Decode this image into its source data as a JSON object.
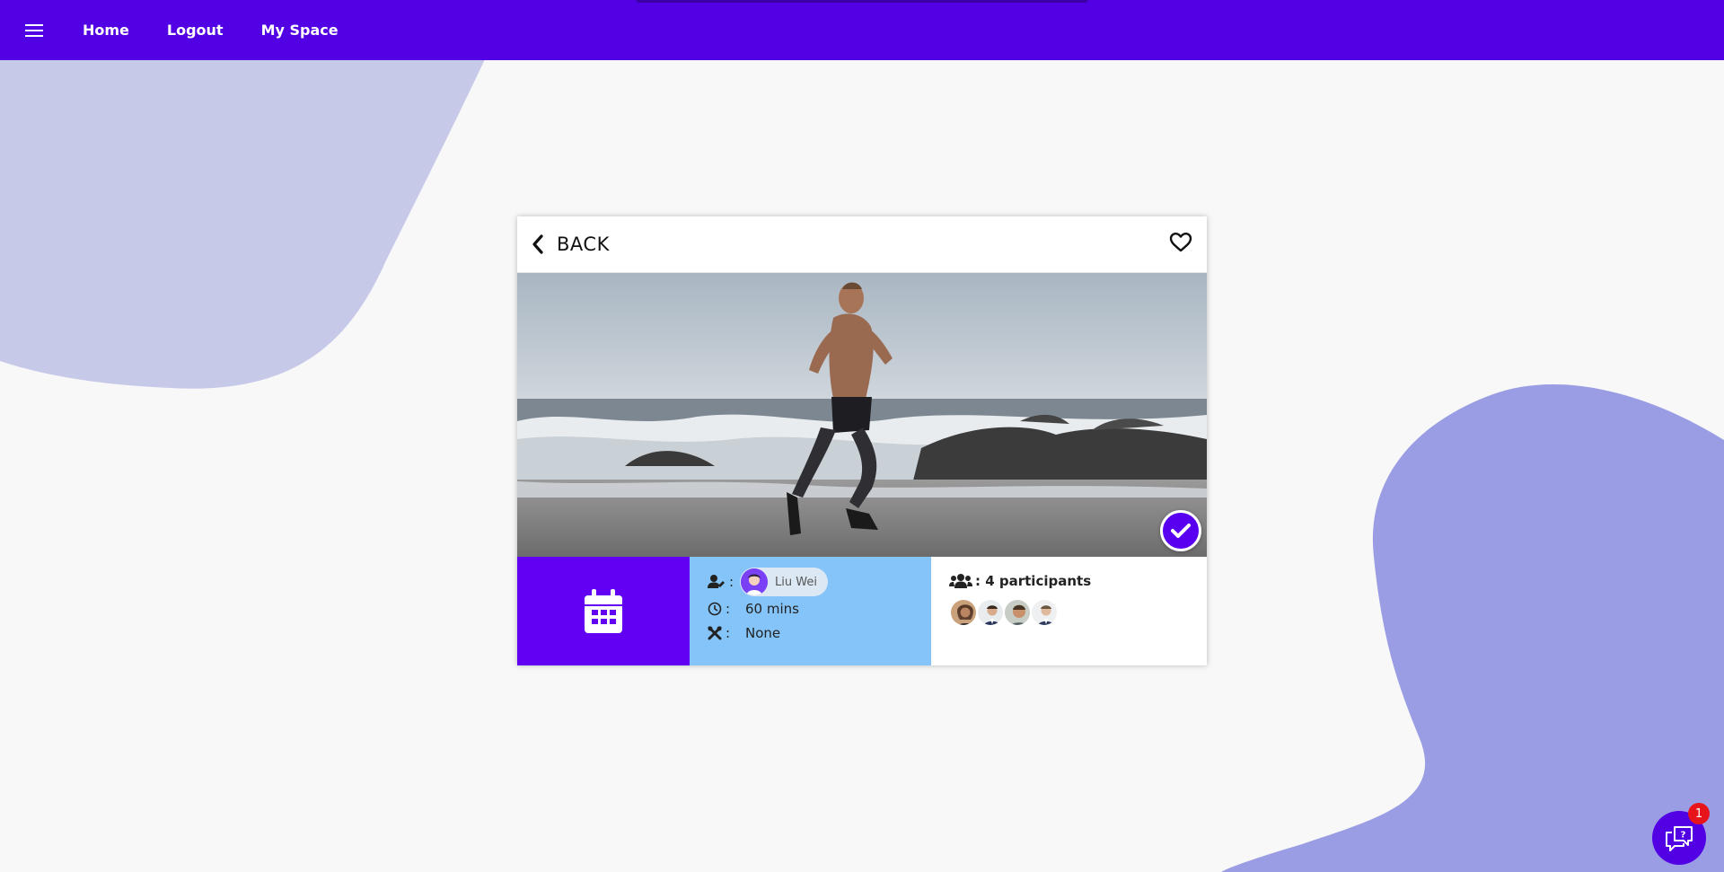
{
  "colors": {
    "nav": "#5200e4",
    "accent": "#6100f3",
    "info_bg": "#85c4f8",
    "blob_light": "#c7c9e9",
    "blob_dark": "#9a9de4",
    "badge": "#e8141b"
  },
  "nav": {
    "menu_icon": "hamburger-icon",
    "links": [
      "Home",
      "Logout",
      "My Space"
    ]
  },
  "card": {
    "back_label": "BACK",
    "favorite_icon": "heart-outline-icon",
    "image_alt": "runner on beach",
    "completed_icon": "check-icon",
    "date_icon": "calendar-icon",
    "organizer_label": ":",
    "organizer_name": "Liu Wei",
    "duration_label": ":",
    "duration": "60 mins",
    "equipment_label": ":",
    "equipment": "None",
    "participants_text": ": 4 participants",
    "participants_count": 4
  },
  "chat": {
    "icon": "chat-help-icon",
    "badge": "1"
  }
}
